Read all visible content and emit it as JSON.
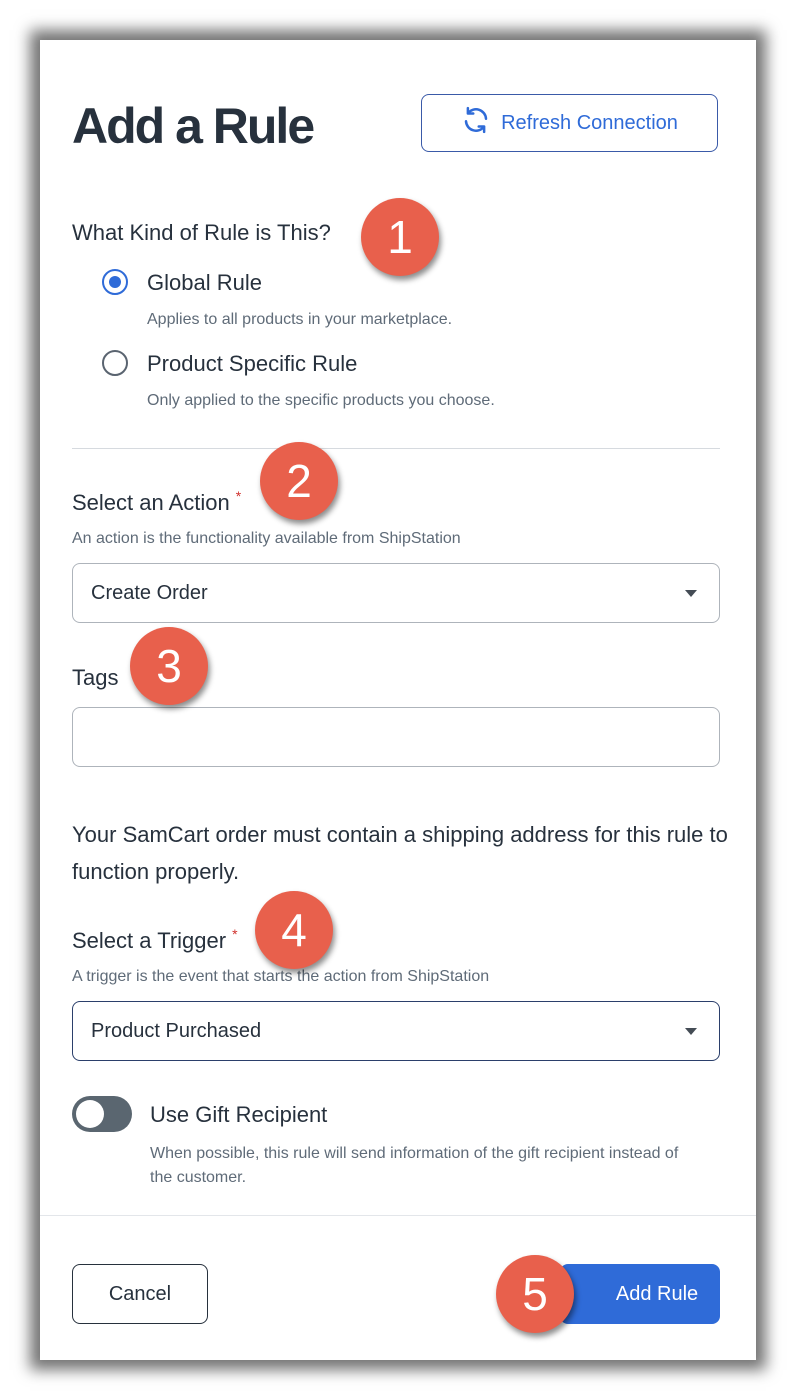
{
  "modal": {
    "title": "Add a Rule",
    "refresh_label": "Refresh Connection"
  },
  "rule_type": {
    "question": "What Kind of Rule is This?",
    "options": [
      {
        "label": "Global Rule",
        "description": "Applies to all products in your marketplace.",
        "checked": true
      },
      {
        "label": "Product Specific Rule",
        "description": "Only applied to the specific products you choose.",
        "checked": false
      }
    ]
  },
  "action": {
    "label": "Select an Action",
    "required_mark": "*",
    "help": "An action is the functionality available from ShipStation",
    "value": "Create Order"
  },
  "tags": {
    "label": "Tags",
    "value": ""
  },
  "notice": "Your SamCart order must contain a shipping address for this rule to function properly.",
  "trigger": {
    "label": "Select a Trigger",
    "required_mark": "*",
    "help": "A trigger is the event that starts the action from ShipStation",
    "value": "Product Purchased"
  },
  "gift": {
    "label": "Use Gift Recipient",
    "description": "When possible, this rule will send information of the gift recipient instead of the customer.",
    "enabled": false
  },
  "footer": {
    "cancel_label": "Cancel",
    "submit_label": "Add Rule"
  },
  "badges": [
    "1",
    "2",
    "3",
    "4",
    "5"
  ],
  "colors": {
    "accent": "#2f6bd8",
    "badge": "#e8604c",
    "text": "#27313d",
    "required": "#d0312d"
  }
}
